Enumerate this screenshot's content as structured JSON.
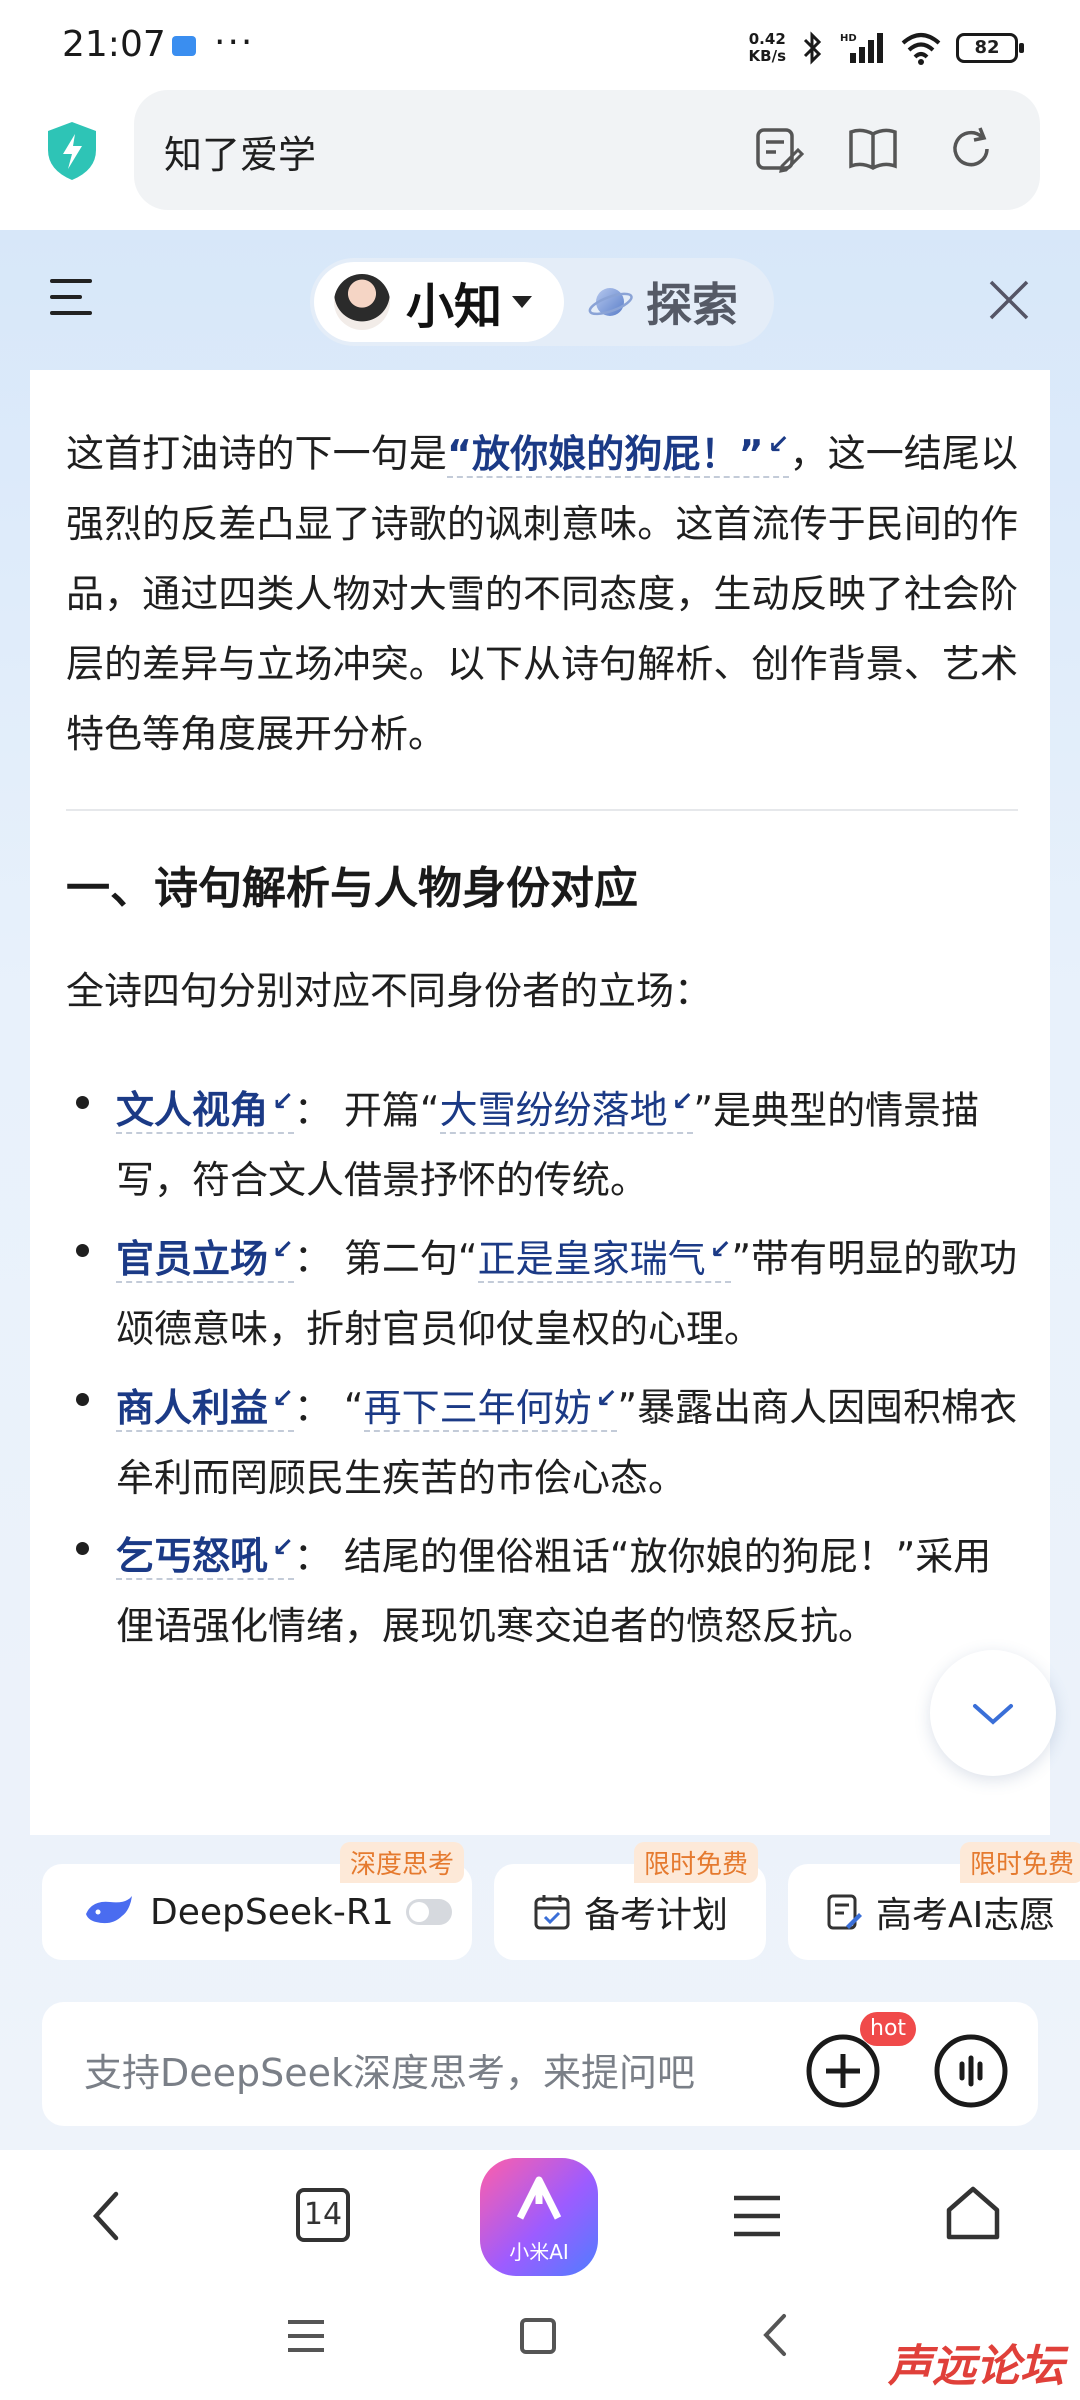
{
  "status_bar": {
    "time": "21:07",
    "dots": "···",
    "net_speed_value": "0.42",
    "net_speed_unit": "KB/s",
    "signal_label": "HD",
    "battery": "82"
  },
  "browser": {
    "address": "知了爱学"
  },
  "panel": {
    "tab_active": "小知",
    "tab_explore": "探索"
  },
  "content": {
    "para1_a": "这首打油诗的下一句是",
    "para1_quote": "“放你娘的狗屁！”",
    "para1_b": "，这一结尾以强烈的反差凸显了诗歌的讽刺意味。这首流传于民间的作品，通过四类人物对大雪的不同态度，生动反映了社会阶层的差异与立场冲突。以下从诗句解析、创作背景、艺术特色等角度展开分析。",
    "ref_arrow": "↙",
    "section1_heading": "一、诗句解析与人物身份对应",
    "intro": "全诗四句分别对应不同身份者的立场：",
    "items": [
      {
        "term": "文人视角",
        "pre": "： 开篇“",
        "quote": "大雪纷纷落地",
        "post": "”是典型的情景描写，符合文人借景抒怀的传统。"
      },
      {
        "term": "官员立场",
        "pre": "： 第二句“",
        "quote": "正是皇家瑞气",
        "post": "”带有明显的歌功颂德意味，折射官员仰仗皇权的心理。"
      },
      {
        "term": "商人利益",
        "pre": "： “",
        "quote": "再下三年何妨",
        "post": "”暴露出商人因囤积棉衣牟利而罔顾民生疾苦的市侩心态。"
      },
      {
        "term": "乞丐怒吼",
        "pre": "： 结尾的俚俗粗话“放你娘的狗屁！”采用俚语强化情绪，展现饥寒交迫者的愤怒反抗。",
        "quote": "",
        "post": ""
      }
    ]
  },
  "chips": [
    {
      "label": "DeepSeek-R1",
      "badge": "深度思考"
    },
    {
      "label": "备考计划",
      "badge": "限时免费"
    },
    {
      "label": "高考AI志愿",
      "badge": "限时免费"
    }
  ],
  "input": {
    "placeholder": "支持DeepSeek深度思考，来提问吧",
    "hot_badge": "hot"
  },
  "bottom_nav": {
    "tab_count": "14",
    "ai_label": "小米AI"
  },
  "watermark": "声远论坛",
  "colors": {
    "accent_blue": "#1b3a86",
    "badge_orange": "#e57a2f",
    "hot_red": "#f04a4a",
    "shield_teal": "#2ec4b6"
  }
}
